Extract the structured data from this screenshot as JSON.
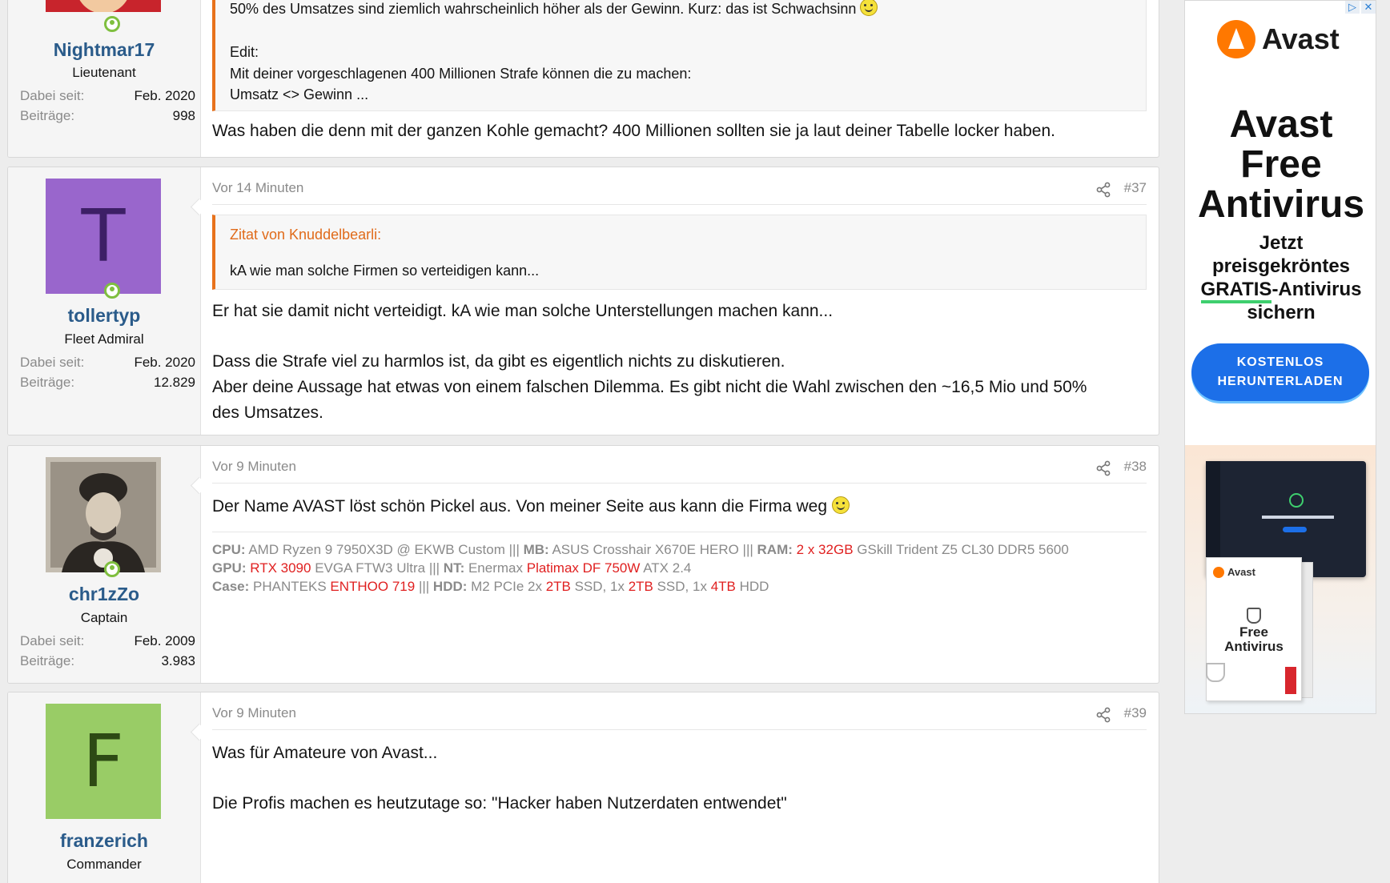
{
  "posts": [
    {
      "user": {
        "name": "Nightmar17",
        "title": "Lieutenant",
        "joined_label": "Dabei seit:",
        "joined": "Feb. 2020",
        "posts_label": "Beiträge:",
        "posts": "998",
        "avatar_color": "#c8242c"
      },
      "quote_lines": [
        "50% des Umsatzes sind ziemlich wahrscheinlich höher als der Gewinn. Kurz: das ist Schwachsinn",
        "Edit:",
        "Mit deiner vorgeschlagenen 400 Millionen Strafe können die zu machen:",
        "Umsatz <> Gewinn ..."
      ],
      "body": [
        "Was haben die denn mit der ganzen Kohle gemacht? 400 Millionen sollten sie ja laut deiner Tabelle locker haben."
      ]
    },
    {
      "time": "Vor 14 Minuten",
      "number": "#37",
      "user": {
        "name": "tollertyp",
        "title": "Fleet Admiral",
        "joined_label": "Dabei seit:",
        "joined": "Feb. 2020",
        "posts_label": "Beiträge:",
        "posts": "12.829",
        "avatar_letter": "T",
        "avatar_color": "#9966cc",
        "avatar_letter_color": "#3d1f66"
      },
      "quote": {
        "title": "Zitat von Knuddelbearli:",
        "text": "kA wie man solche Firmen so verteidigen kann..."
      },
      "body": [
        "Er hat sie damit nicht verteidigt. kA wie man solche Unterstellungen machen kann...",
        "Dass die Strafe viel zu harmlos ist, da gibt es eigentlich nichts zu diskutieren.",
        "Aber deine Aussage hat etwas von einem falschen Dilemma. Es gibt nicht die Wahl zwischen den ~16,5 Mio und 50%",
        "des Umsatzes."
      ]
    },
    {
      "time": "Vor 9 Minuten",
      "number": "#38",
      "user": {
        "name": "chr1zZo",
        "title": "Captain",
        "joined_label": "Dabei seit:",
        "joined": "Feb. 2009",
        "posts_label": "Beiträge:",
        "posts": "3.983"
      },
      "body": [
        "Der Name AVAST löst schön Pickel aus. Von meiner Seite aus kann die Firma weg"
      ],
      "signature": {
        "l1": [
          {
            "t": "CPU:",
            "s": "b"
          },
          {
            "t": " AMD Ryzen 9 7950X3D @ EKWB Custom ||| ",
            "s": "n"
          },
          {
            "t": "MB:",
            "s": "b"
          },
          {
            "t": " ASUS Crosshair X670E HERO ||| ",
            "s": "n"
          },
          {
            "t": "RAM:",
            "s": "b"
          },
          {
            "t": " ",
            "s": "n"
          },
          {
            "t": "2 x 32GB",
            "s": "r"
          },
          {
            "t": " GSkill Trident Z5 CL30 DDR5 5600",
            "s": "n"
          }
        ],
        "l2": [
          {
            "t": "GPU:",
            "s": "b"
          },
          {
            "t": " ",
            "s": "n"
          },
          {
            "t": "RTX 3090",
            "s": "r"
          },
          {
            "t": " EVGA FTW3 Ultra ||| ",
            "s": "n"
          },
          {
            "t": "NT:",
            "s": "b"
          },
          {
            "t": " Enermax ",
            "s": "n"
          },
          {
            "t": "Platimax DF 750W",
            "s": "r"
          },
          {
            "t": " ATX 2.4",
            "s": "n"
          }
        ],
        "l3": [
          {
            "t": "Case:",
            "s": "b"
          },
          {
            "t": " PHANTEKS ",
            "s": "n"
          },
          {
            "t": "ENTHOO 719",
            "s": "r"
          },
          {
            "t": " ||| ",
            "s": "n"
          },
          {
            "t": "HDD:",
            "s": "b"
          },
          {
            "t": " M2 PCIe 2x ",
            "s": "n"
          },
          {
            "t": "2TB",
            "s": "r"
          },
          {
            "t": " SSD, 1x ",
            "s": "n"
          },
          {
            "t": "2TB",
            "s": "r"
          },
          {
            "t": " SSD, 1x ",
            "s": "n"
          },
          {
            "t": "4TB",
            "s": "r"
          },
          {
            "t": " HDD",
            "s": "n"
          }
        ]
      }
    },
    {
      "time": "Vor 9 Minuten",
      "number": "#39",
      "user": {
        "name": "franzerich",
        "title": "Commander",
        "avatar_letter": "F",
        "avatar_color": "#99cc66",
        "avatar_letter_color": "#2d4a14"
      },
      "body": [
        "Was für Amateure von Avast...",
        "Die Profis machen es heutzutage so: \"Hacker haben Nutzerdaten entwendet\""
      ]
    }
  ],
  "ad": {
    "brand": "Avast",
    "headline": [
      "Avast",
      "Free",
      "Antivirus"
    ],
    "sub": [
      "Jetzt",
      "preisgekröntes"
    ],
    "sub_hl": "GRATIS",
    "sub_rest": "-Antivirus",
    "sub_last": "sichern",
    "cta": [
      "KOSTENLOS",
      "HERUNTERLADEN"
    ],
    "box_brand": "Avast",
    "box_name": [
      "Free",
      "Antivirus"
    ],
    "brand_color": "#ff7800",
    "cta_color": "#1c6fe8"
  },
  "theme": {
    "link_color": "#2a5b8a",
    "quote_accent": "#e8721c",
    "online_color": "#7fbf3f",
    "sig_red": "#e02020"
  }
}
